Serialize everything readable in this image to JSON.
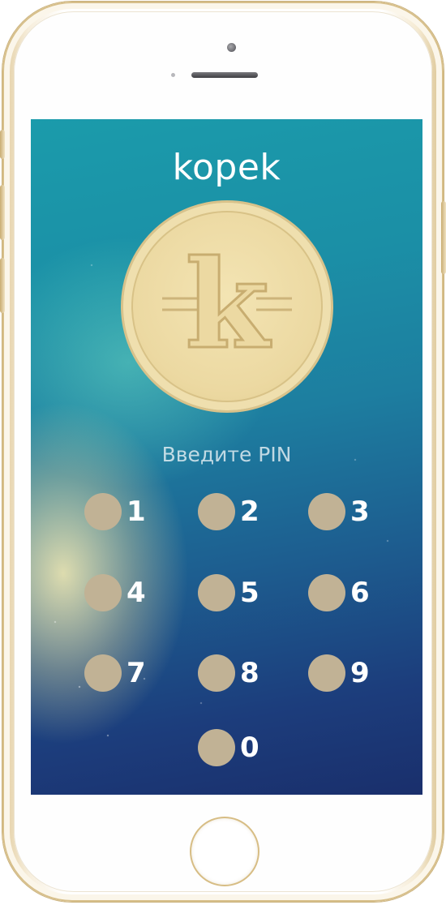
{
  "app": {
    "title": "kopek",
    "logo_letter": "k"
  },
  "lock_screen": {
    "prompt": "Введите PIN",
    "keypad": [
      {
        "digit": "1"
      },
      {
        "digit": "2"
      },
      {
        "digit": "3"
      },
      {
        "digit": "4"
      },
      {
        "digit": "5"
      },
      {
        "digit": "6"
      },
      {
        "digit": "7"
      },
      {
        "digit": "8"
      },
      {
        "digit": "9"
      },
      {
        "digit": "0"
      }
    ]
  },
  "colors": {
    "key_dot": "#c1b295",
    "coin": "#ecd9a2",
    "text": "#ffffff",
    "screen_top": "#1b9bab",
    "screen_bottom": "#1a2f6c"
  }
}
